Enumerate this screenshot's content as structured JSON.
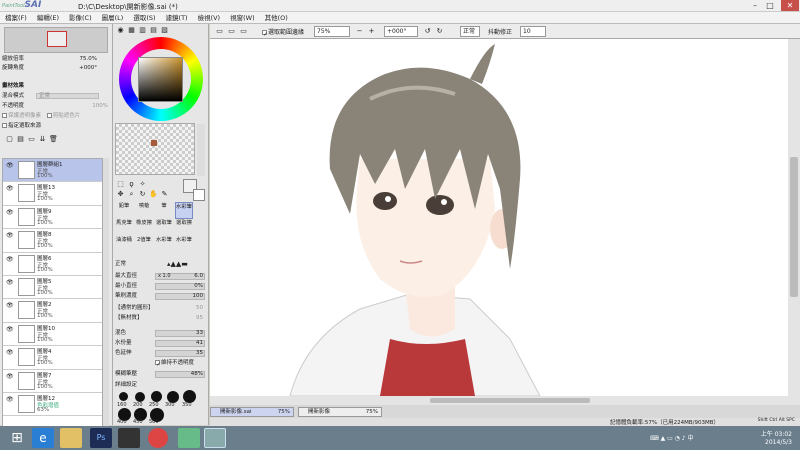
{
  "window": {
    "logo_text": "SAI",
    "logo_small": "PaintTool",
    "title": "D:\\C\\Desktop\\開新影像.sai (*)",
    "min": "–",
    "max": "□",
    "close": "✕"
  },
  "menu": [
    "檔案(F)",
    "編輯(E)",
    "影像(C)",
    "圖層(L)",
    "選取(S)",
    "濾鏡(T)",
    "檢視(V)",
    "視窗(W)",
    "其他(O)"
  ],
  "navigator": {
    "zoom_label": "縮放倍率",
    "zoom_value": "75.0%",
    "rotate_label": "旋轉角度",
    "rotate_value": "+000°"
  },
  "layer_props": {
    "section": "畫材效果",
    "blend_label": "混合模式",
    "blend_value": "正常",
    "opacity_label": "不透明度",
    "opacity_value": "100%",
    "clip": "保護透明像素",
    "clip2": "剪貼遮色片",
    "sel_source": "指定選取來源"
  },
  "layers": [
    {
      "name": "圖層群組1",
      "mode": "正常",
      "opacity": "100%",
      "sel": true
    },
    {
      "name": "圖層13",
      "mode": "正常",
      "opacity": "100%"
    },
    {
      "name": "圖層9",
      "mode": "正常",
      "opacity": "100%"
    },
    {
      "name": "圖層8",
      "mode": "正常",
      "opacity": "100%"
    },
    {
      "name": "圖層6",
      "mode": "正常",
      "opacity": "100%"
    },
    {
      "name": "圖層5",
      "mode": "正常",
      "opacity": "100%"
    },
    {
      "name": "圖層2",
      "mode": "正常",
      "opacity": "100%"
    },
    {
      "name": "圖層10",
      "mode": "正常",
      "opacity": "100%"
    },
    {
      "name": "圖層4",
      "mode": "正常",
      "opacity": "100%"
    },
    {
      "name": "圖層7",
      "mode": "正常",
      "opacity": "100%"
    },
    {
      "name": "圖層12",
      "mode": "色彩增值",
      "opacity": "63%"
    }
  ],
  "tools": [
    "鉛筆",
    "噴槍",
    "筆",
    "水彩筆",
    "馬克筆",
    "橡皮擦",
    "選取筆",
    "選取擦",
    "油漆桶",
    "2值筆",
    "水彩筆",
    "水彩筆"
  ],
  "brush": {
    "mode": "正常",
    "max_label": "最大直徑",
    "max_value": "6.0",
    "max_mult": "x 1.0",
    "min_label": "最小直徑",
    "min_value": "0%",
    "density_label": "筆刷濃度",
    "density_value": "100",
    "shape_label": "【通常的圓形】",
    "shape_value": "50",
    "tex_label": "【無材質】",
    "tex_value": "95",
    "blend_label": "混色",
    "blend_value": "33",
    "water_label": "水份量",
    "water_value": "41",
    "stretch_label": "色延伸",
    "stretch_value": "35",
    "keep_label": "維持不透明度",
    "fuzzy_label": "模糊筆壓",
    "fuzzy_value": "48%",
    "detail_label": "詳細設定",
    "sizes": [
      "160",
      "200",
      "250",
      "300",
      "350",
      "400",
      "450",
      "500"
    ]
  },
  "toolbar": {
    "sel_edge": "選取範圍邊緣",
    "zoom": "75%",
    "angle": "+000°",
    "mode": "正常",
    "stab_label": "抖動修正",
    "stab": "10"
  },
  "doc_tabs": [
    {
      "name": "開新影像.sai",
      "zoom": "75%"
    },
    {
      "name": "開新影像",
      "zoom": "75%"
    }
  ],
  "status": {
    "memory": "記憶體負載率:57%（已用224MB/903MB）",
    "keys": "Shift Ctrl Alt SPC"
  },
  "taskbar": {
    "time": "上午 03:02",
    "date": "2014/5/3"
  }
}
